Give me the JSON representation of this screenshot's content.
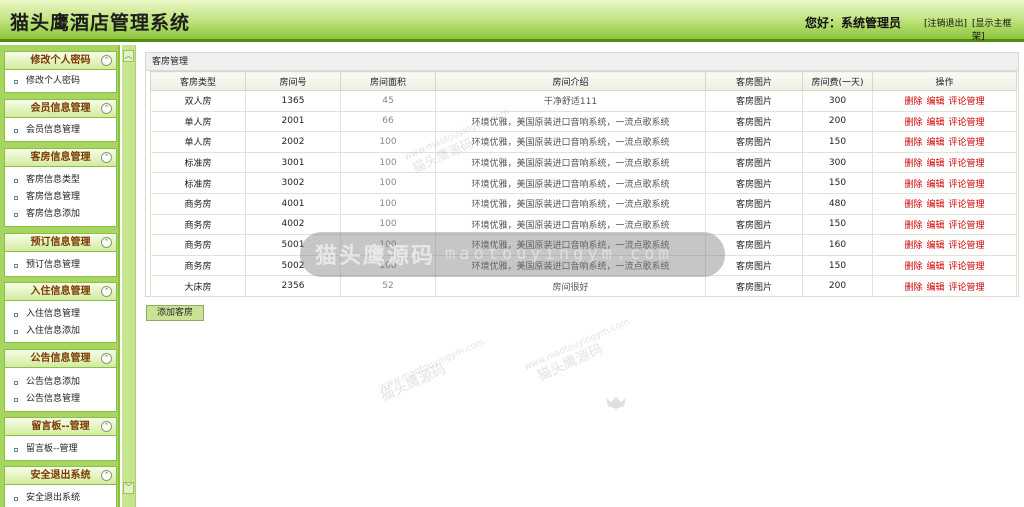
{
  "header": {
    "app_title": "猫头鹰酒店管理系统",
    "greeting": "您好：系统管理员",
    "logout_link": "[注销退出]",
    "mainframe_link": "[显示主框架]"
  },
  "sidebar": {
    "toggle_glyph": "⌃",
    "sections": [
      {
        "title": "修改个人密码",
        "items": [
          "修改个人密码"
        ]
      },
      {
        "title": "会员信息管理",
        "items": [
          "会员信息管理"
        ]
      },
      {
        "title": "客房信息管理",
        "items": [
          "客房信息类型",
          "客房信息管理",
          "客房信息添加"
        ]
      },
      {
        "title": "预订信息管理",
        "items": [
          "预订信息管理"
        ]
      },
      {
        "title": "入住信息管理",
        "items": [
          "入住信息管理",
          "入住信息添加"
        ]
      },
      {
        "title": "公告信息管理",
        "items": [
          "公告信息添加",
          "公告信息管理"
        ]
      },
      {
        "title": "留言板--管理",
        "items": [
          "留言板--管理"
        ]
      },
      {
        "title": "安全退出系统",
        "items": [
          "安全退出系统"
        ]
      }
    ]
  },
  "scrollbar": {
    "up_glyph": "︿",
    "down_glyph": "﹀"
  },
  "main": {
    "panel_title": "客房管理",
    "columns": [
      "客房类型",
      "房间号",
      "房间面积",
      "房间介绍",
      "客房图片",
      "房间费(一天)",
      "操作"
    ],
    "rows": [
      {
        "type": "双人房",
        "room_no": "1365",
        "area": "45",
        "intro": "干净舒适111",
        "image": "客房图片",
        "fee": "300"
      },
      {
        "type": "单人房",
        "room_no": "2001",
        "area": "66",
        "intro": "环境优雅，美国原装进口音响系统，一流点歌系统",
        "image": "客房图片",
        "fee": "200"
      },
      {
        "type": "单人房",
        "room_no": "2002",
        "area": "100",
        "intro": "环境优雅，美国原装进口音响系统，一流点歌系统",
        "image": "客房图片",
        "fee": "150"
      },
      {
        "type": "标准房",
        "room_no": "3001",
        "area": "100",
        "intro": "环境优雅，美国原装进口音响系统，一流点歌系统",
        "image": "客房图片",
        "fee": "300"
      },
      {
        "type": "标准房",
        "room_no": "3002",
        "area": "100",
        "intro": "环境优雅，美国原装进口音响系统，一流点歌系统",
        "image": "客房图片",
        "fee": "150"
      },
      {
        "type": "商务房",
        "room_no": "4001",
        "area": "100",
        "intro": "环境优雅，美国原装进口音响系统，一流点歌系统",
        "image": "客房图片",
        "fee": "480"
      },
      {
        "type": "商务房",
        "room_no": "4002",
        "area": "100",
        "intro": "环境优雅，美国原装进口音响系统，一流点歌系统",
        "image": "客房图片",
        "fee": "150"
      },
      {
        "type": "商务房",
        "room_no": "5001",
        "area": "100",
        "intro": "环境优雅，美国原装进口音响系统，一流点歌系统",
        "image": "客房图片",
        "fee": "160"
      },
      {
        "type": "商务房",
        "room_no": "5002",
        "area": "100",
        "intro": "环境优雅，美国原装进口音响系统，一流点歌系统",
        "image": "客房图片",
        "fee": "150"
      },
      {
        "type": "大床房",
        "room_no": "2356",
        "area": "52",
        "intro": "房间很好",
        "image": "客房图片",
        "fee": "200"
      }
    ],
    "actions": {
      "delete": "删除",
      "edit": "编辑",
      "review": "评论管理"
    },
    "add_button": "添加客房"
  },
  "watermark": {
    "brand_cn": "猫头鹰源码",
    "brand_en": "maotouyingym.com",
    "small_domain": "www.maotouyingym.com"
  },
  "colors": {
    "header_green": "#8cc43a",
    "sidebar_green": "#a6d560",
    "section_title": "#7a3a00",
    "action_red": "#d10000"
  }
}
